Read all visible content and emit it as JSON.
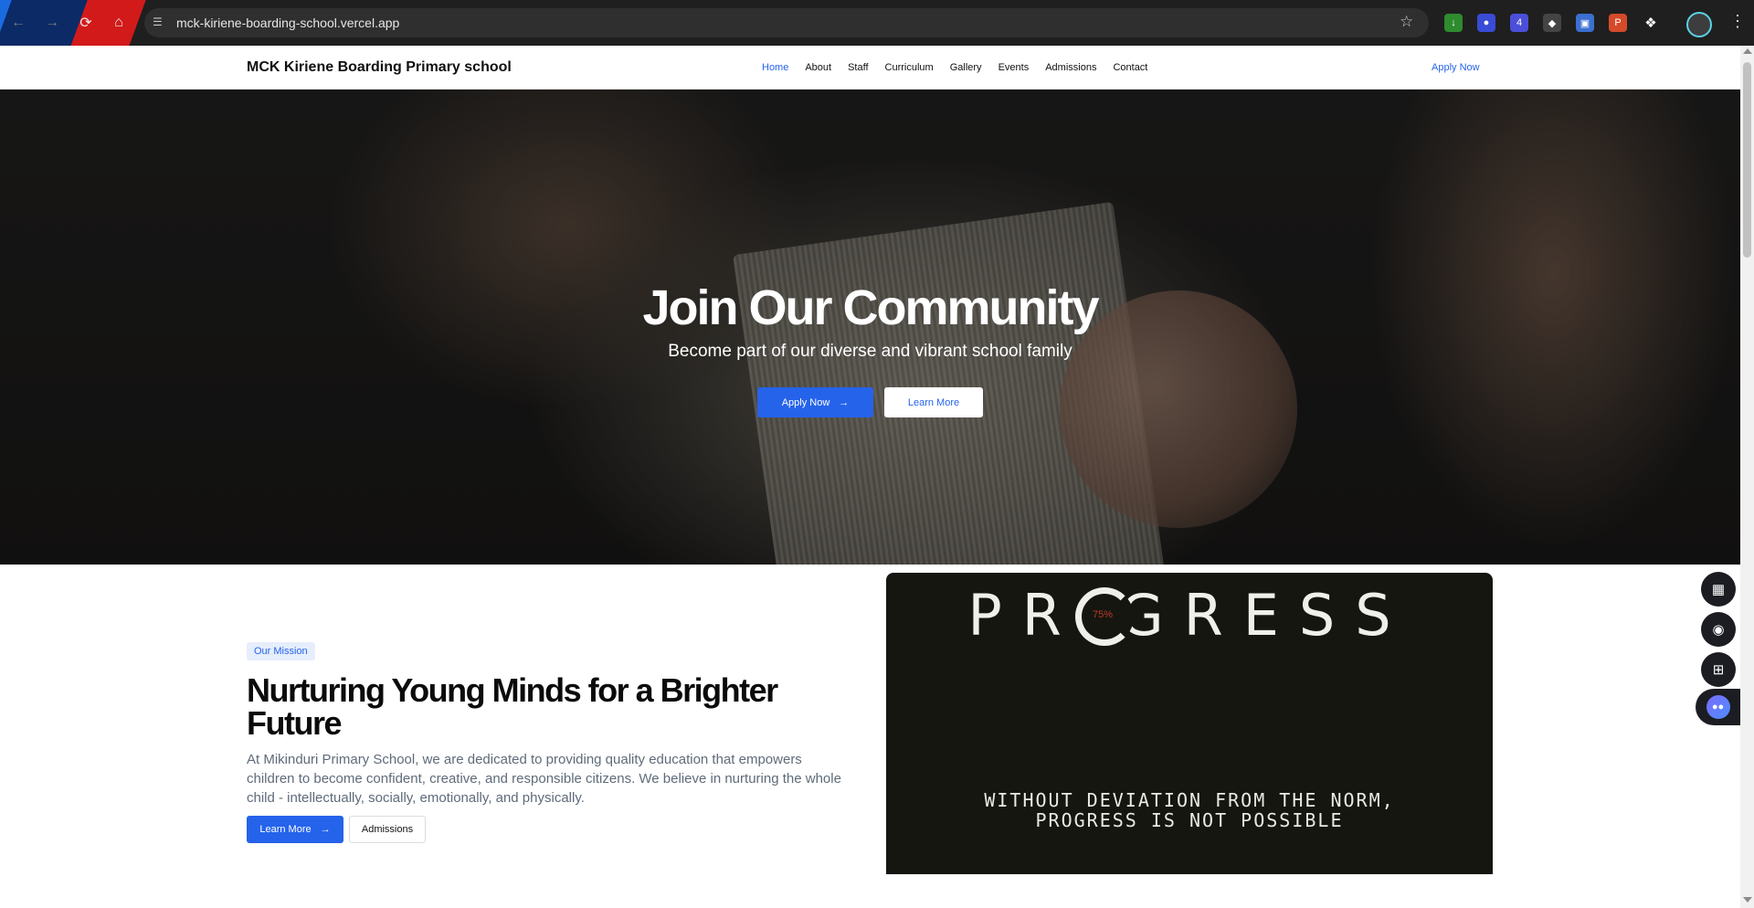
{
  "browser": {
    "url": "mck-kiriene-boarding-school.vercel.app",
    "extension_badge": "4",
    "icons": [
      "back-icon",
      "forward-icon",
      "reload-icon",
      "home-icon",
      "site-info-icon",
      "bookmark-star-icon",
      "extensions-puzzle-icon",
      "profile-icon",
      "menu-kebab-icon"
    ]
  },
  "header": {
    "brand": "MCK Kiriene Boarding Primary school",
    "nav": [
      "Home",
      "About",
      "Staff",
      "Curriculum",
      "Gallery",
      "Events",
      "Admissions",
      "Contact"
    ],
    "active_nav": "Home",
    "apply_link": "Apply Now"
  },
  "hero": {
    "title": "Join Our Community",
    "subtitle": "Become part of our diverse and vibrant school family",
    "primary_button": "Apply Now",
    "secondary_button": "Learn More",
    "slide_count": 3,
    "active_slide": 3
  },
  "mission": {
    "badge": "Our Mission",
    "title": "Nurturing Young Minds for a Brighter Future",
    "text": "At Mikinduri Primary School, we are dedicated to providing quality education that empowers children to become confident, creative, and responsible citizens. We believe in nurturing the whole child - intellectually, socially, emotionally, and physically.",
    "learn_button": "Learn More",
    "admissions_button": "Admissions"
  },
  "image": {
    "word": "PR GRESS",
    "percent": "75%",
    "quote_line1": "WITHOUT DEVIATION FROM THE NORM,",
    "quote_line2": "PROGRESS IS NOT POSSIBLE"
  },
  "colors": {
    "accent": "#2563eb",
    "heading": "#0b0b0b",
    "body_text": "#5f6b7a"
  }
}
